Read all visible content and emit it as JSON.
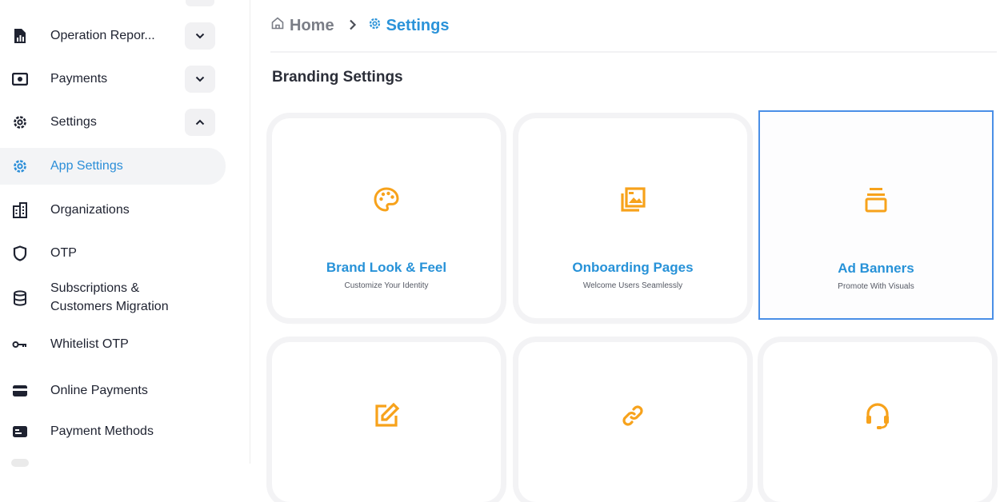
{
  "sidebar": {
    "items": [
      {
        "label": "Operation Repor...",
        "icon": "report-icon",
        "chevron": "down"
      },
      {
        "label": "Payments",
        "icon": "camera-payment-icon",
        "chevron": "down"
      },
      {
        "label": "Settings",
        "icon": "gear-icon",
        "chevron": "up"
      },
      {
        "label": "App Settings",
        "icon": "gear-icon",
        "active": true
      },
      {
        "label": "Organizations",
        "icon": "building-icon"
      },
      {
        "label": "OTP",
        "icon": "shield-icon"
      },
      {
        "label": "Subscriptions &",
        "label2": "Customers Migration",
        "icon": "database-icon"
      },
      {
        "label": "Whitelist OTP",
        "icon": "key-icon"
      },
      {
        "label": "Online Payments",
        "icon": "credit-card-icon"
      },
      {
        "label": "Payment Methods",
        "icon": "payment-method-icon"
      }
    ]
  },
  "breadcrumb": {
    "home": "Home",
    "current": "Settings"
  },
  "page": {
    "title": "Branding Settings"
  },
  "cards": [
    {
      "title": "Brand Look & Feel",
      "subtitle": "Customize Your Identity",
      "icon": "palette-icon"
    },
    {
      "title": "Onboarding Pages",
      "subtitle": "Welcome Users Seamlessly",
      "icon": "gallery-icon"
    },
    {
      "title": "Ad Banners",
      "subtitle": "Promote With Visuals",
      "icon": "banner-stack-icon"
    },
    {
      "title": "",
      "subtitle": "",
      "icon": "edit-icon"
    },
    {
      "title": "",
      "subtitle": "",
      "icon": "link-icon"
    },
    {
      "title": "",
      "subtitle": "",
      "icon": "headset-icon"
    }
  ],
  "colors": {
    "accent": "#2b93d9",
    "icon_orange": "#f7a21b",
    "selected_border": "#4a8fe7"
  }
}
